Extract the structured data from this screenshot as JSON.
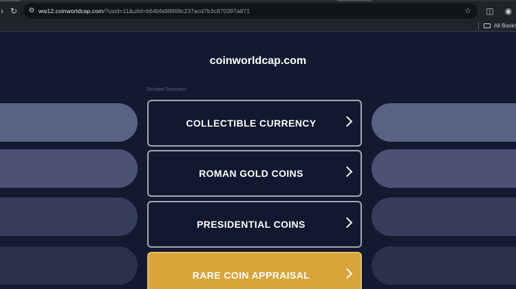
{
  "browser": {
    "url_host": "ww12.coinworldcap.com",
    "url_path": "/?usid=11&utid=b64bfa98869c237acd7b3c870397a871",
    "bookmarks_label": "All Bookm"
  },
  "page": {
    "site_title": "coinworldcap.com",
    "related_label": "Related Searches:",
    "results": [
      {
        "label": "COLLECTIBLE CURRENCY"
      },
      {
        "label": "ROMAN GOLD COINS"
      },
      {
        "label": "PRESIDENTIAL COINS"
      },
      {
        "label": "RARE COIN APPRAISAL"
      }
    ]
  },
  "colors": {
    "page_bg": "#131a30",
    "featured_bg": "#d9a53a",
    "side_pill_colors": [
      "#5a6283",
      "#4b5273",
      "#353d5a",
      "#2a3148"
    ]
  }
}
